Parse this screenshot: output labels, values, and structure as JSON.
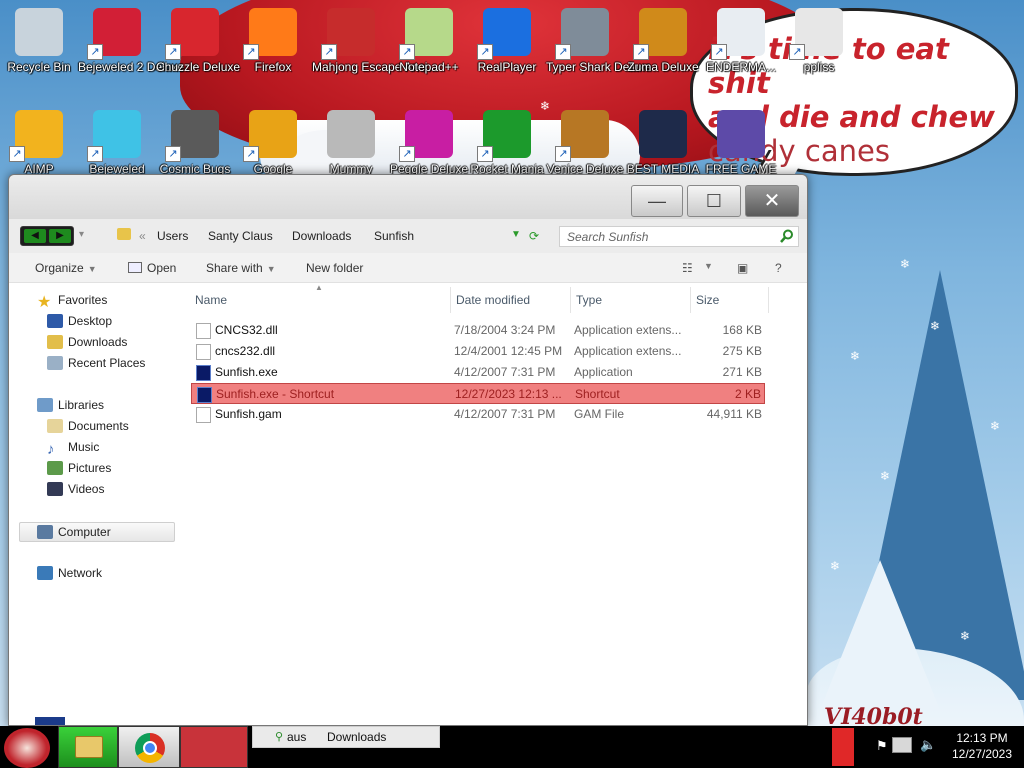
{
  "desktop": {
    "icons_row1": [
      {
        "label": "Recycle Bin",
        "color": "#c8d3dc",
        "shortcut": false
      },
      {
        "label": "Bejeweled 2 Deluxe",
        "color": "#d21f36",
        "shortcut": true
      },
      {
        "label": "Chuzzle Deluxe",
        "color": "#d8262e",
        "shortcut": true
      },
      {
        "label": "Firefox",
        "color": "#ff7a18",
        "shortcut": true
      },
      {
        "label": "Mahjong Escape Anci...",
        "color": "#c62c2c",
        "shortcut": true
      },
      {
        "label": "Notepad++",
        "color": "#b6d98a",
        "shortcut": true
      },
      {
        "label": "RealPlayer",
        "color": "#1b6fe0",
        "shortcut": true
      },
      {
        "label": "Typer Shark Deluxe",
        "color": "#7f8c99",
        "shortcut": true
      },
      {
        "label": "Zuma Deluxe",
        "color": "#d08a1a",
        "shortcut": true
      },
      {
        "label": "ENDERMA...",
        "color": "#e8edf2",
        "shortcut": true
      },
      {
        "label": "ppliss",
        "color": "#e7e7e7",
        "shortcut": true
      }
    ],
    "icons_row2": [
      {
        "label": "AIMP",
        "color": "#f2b31e",
        "shortcut": true
      },
      {
        "label": "Bejeweled",
        "color": "#3fc2e6",
        "shortcut": true
      },
      {
        "label": "Cosmic Bugs",
        "color": "#5a5a5a",
        "shortcut": true
      },
      {
        "label": "Google",
        "color": "#e8a316",
        "shortcut": true
      },
      {
        "label": "Mummy",
        "color": "#b9b9b9",
        "shortcut": false
      },
      {
        "label": "Peggle Deluxe",
        "color": "#c81ea3",
        "shortcut": true
      },
      {
        "label": "Rocket Mania",
        "color": "#1c9a2c",
        "shortcut": true
      },
      {
        "label": "Venice Deluxe",
        "color": "#b77724",
        "shortcut": true
      },
      {
        "label": "BEST MEDIA",
        "color": "#1e2a4a",
        "shortcut": false
      },
      {
        "label": "FREE GAME",
        "color": "#5d4aa8",
        "shortcut": false
      }
    ],
    "speech_bubble": {
      "line1": "it's time to eat shit",
      "line2": "and die and chew",
      "line3": "candy canes"
    },
    "signature": "VI40b0t"
  },
  "window": {
    "title_buttons": {
      "minimize": "—",
      "maximize": "☐",
      "close": "✕"
    },
    "breadcrumb": [
      "Users",
      "Santy Claus",
      "Downloads",
      "Sunfish"
    ],
    "search_placeholder": "Search Sunfish",
    "toolbar": {
      "organize": "Organize",
      "open": "Open",
      "share_with": "Share with",
      "new_folder": "New folder",
      "help": "?"
    },
    "nav": {
      "favorites": "Favorites",
      "desktop": "Desktop",
      "downloads": "Downloads",
      "recent_places": "Recent Places",
      "libraries": "Libraries",
      "documents": "Documents",
      "music": "Music",
      "pictures": "Pictures",
      "videos": "Videos",
      "computer": "Computer",
      "network": "Network"
    },
    "columns": {
      "name": "Name",
      "date": "Date modified",
      "type": "Type",
      "size": "Size"
    },
    "files": [
      {
        "name": "CNCS32.dll",
        "date": "7/18/2004 3:24 PM",
        "type": "Application extens...",
        "size": "168 KB",
        "kind": "doc"
      },
      {
        "name": "cncs232.dll",
        "date": "12/4/2001 12:45 PM",
        "type": "Application extens...",
        "size": "275 KB",
        "kind": "doc"
      },
      {
        "name": "Sunfish.exe",
        "date": "4/12/2007 7:31 PM",
        "type": "Application",
        "size": "271 KB",
        "kind": "app"
      },
      {
        "name": "Sunfish.exe - Shortcut",
        "date": "12/27/2023 12:13 ...",
        "type": "Shortcut",
        "size": "2 KB",
        "kind": "app",
        "selected": true
      },
      {
        "name": "Sunfish.gam",
        "date": "4/12/2007 7:31 PM",
        "type": "GAM File",
        "size": "44,911 KB",
        "kind": "doc"
      }
    ]
  },
  "taskbar": {
    "active_item_prefix": "aus",
    "active_item": "Downloads",
    "time": "12:13 PM",
    "date": "12/27/2023"
  }
}
